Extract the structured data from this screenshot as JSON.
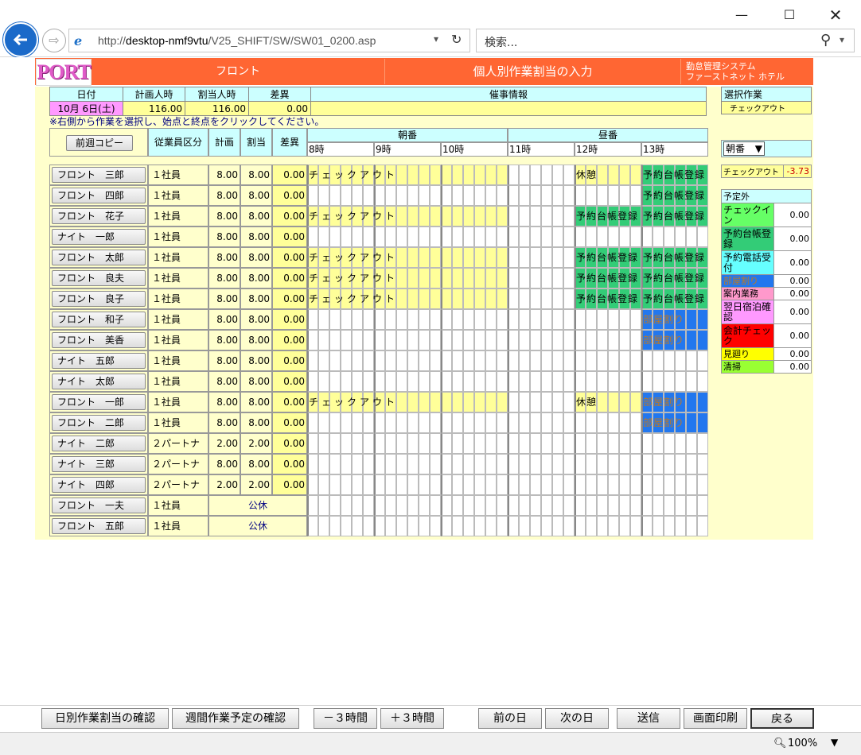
{
  "browser": {
    "url_prefix": "http://",
    "url_host": "desktop-nmf9vtu",
    "url_path": "/V25_SHIFT/SW/SW01_0200.asp",
    "search_placeholder": "検索...",
    "zoom": "100%"
  },
  "header": {
    "logo": "PORT",
    "section": "フロント",
    "title": "個人別作業割当の入力",
    "system": "勤怠管理システム",
    "hotel": "ファーストネット ホテル"
  },
  "summary": {
    "col_date": "日付",
    "col_plan": "計画人時",
    "col_assign": "割当人時",
    "col_diff": "差異",
    "col_event": "催事情報",
    "date": "10月 6日(土)",
    "plan": "116.00",
    "assign": "116.00",
    "diff": "0.00",
    "event": ""
  },
  "instruction": "※右側から作業を選択し、始点と終点をクリックしてください。",
  "controls": {
    "copy_button": "前週コピー",
    "col_type": "従業員区分",
    "col_plan": "計画",
    "col_assign": "割当",
    "col_diff": "差異",
    "shift_morning": "朝番",
    "shift_day": "昼番",
    "hours": [
      "8時",
      "9時",
      "10時",
      "11時",
      "12時",
      "13時"
    ],
    "shift_select": "朝番"
  },
  "selected_task": {
    "heading": "選択作業",
    "value": "チェックアウト"
  },
  "task_top": {
    "name": "チェックアウト",
    "value": "-3.73"
  },
  "unscheduled": {
    "heading": "予定外",
    "items": [
      {
        "name": "チェックイン",
        "value": "0.00",
        "color": "#66ff66"
      },
      {
        "name": "予約台帳登録",
        "value": "0.00",
        "color": "#33cc77"
      },
      {
        "name": "予約電話受付",
        "value": "0.00",
        "color": "#66ffff"
      },
      {
        "name": "部屋割り",
        "value": "0.00",
        "color": "#2277ee"
      },
      {
        "name": "案内業務",
        "value": "0.00",
        "color": "#ff99cc"
      },
      {
        "name": "翌日宿泊確認",
        "value": "0.00",
        "color": "#ff99ff"
      },
      {
        "name": "会計チェック",
        "value": "0.00",
        "color": "#ff0000"
      },
      {
        "name": "見廻り",
        "value": "0.00",
        "color": "#ffff00"
      },
      {
        "name": "清掃",
        "value": "0.00",
        "color": "#99ff33"
      }
    ]
  },
  "labels": {
    "checkout": "チェックアウト",
    "break": "休憩",
    "booking": "予約台帳登録",
    "rooms": "部屋割り",
    "off": "公休"
  },
  "employees": [
    {
      "name": "フロント　三郎",
      "type": "１社員",
      "plan": "8.00",
      "assign": "8.00",
      "diff": "0.00",
      "pattern": "A"
    },
    {
      "name": "フロント　四郎",
      "type": "１社員",
      "plan": "8.00",
      "assign": "8.00",
      "diff": "0.00",
      "pattern": "B"
    },
    {
      "name": "フロント　花子",
      "type": "１社員",
      "plan": "8.00",
      "assign": "8.00",
      "diff": "0.00",
      "pattern": "C"
    },
    {
      "name": "ナイト　一郎",
      "type": "１社員",
      "plan": "8.00",
      "assign": "8.00",
      "diff": "0.00",
      "pattern": "E"
    },
    {
      "name": "フロント　太郎",
      "type": "１社員",
      "plan": "8.00",
      "assign": "8.00",
      "diff": "0.00",
      "pattern": "C"
    },
    {
      "name": "フロント　良夫",
      "type": "１社員",
      "plan": "8.00",
      "assign": "8.00",
      "diff": "0.00",
      "pattern": "C"
    },
    {
      "name": "フロント　良子",
      "type": "１社員",
      "plan": "8.00",
      "assign": "8.00",
      "diff": "0.00",
      "pattern": "C"
    },
    {
      "name": "フロント　和子",
      "type": "１社員",
      "plan": "8.00",
      "assign": "8.00",
      "diff": "0.00",
      "pattern": "D"
    },
    {
      "name": "フロント　美香",
      "type": "１社員",
      "plan": "8.00",
      "assign": "8.00",
      "diff": "0.00",
      "pattern": "D"
    },
    {
      "name": "ナイト　五郎",
      "type": "１社員",
      "plan": "8.00",
      "assign": "8.00",
      "diff": "0.00",
      "pattern": "E"
    },
    {
      "name": "ナイト　太郎",
      "type": "１社員",
      "plan": "8.00",
      "assign": "8.00",
      "diff": "0.00",
      "pattern": "E"
    },
    {
      "name": "フロント　一郎",
      "type": "１社員",
      "plan": "8.00",
      "assign": "8.00",
      "diff": "0.00",
      "pattern": "F"
    },
    {
      "name": "フロント　二郎",
      "type": "１社員",
      "plan": "8.00",
      "assign": "8.00",
      "diff": "0.00",
      "pattern": "D"
    },
    {
      "name": "ナイト　二郎",
      "type": "２パートナ",
      "plan": "2.00",
      "assign": "2.00",
      "diff": "0.00",
      "pattern": "E"
    },
    {
      "name": "ナイト　三郎",
      "type": "２パートナ",
      "plan": "8.00",
      "assign": "8.00",
      "diff": "0.00",
      "pattern": "E"
    },
    {
      "name": "ナイト　四郎",
      "type": "２パートナ",
      "plan": "2.00",
      "assign": "2.00",
      "diff": "0.00",
      "pattern": "E"
    },
    {
      "name": "フロント　一夫",
      "type": "１社員",
      "plan": "",
      "assign": "",
      "diff": "",
      "pattern": "E",
      "off": true
    },
    {
      "name": "フロント　五郎",
      "type": "１社員",
      "plan": "",
      "assign": "",
      "diff": "",
      "pattern": "E",
      "off": true
    }
  ],
  "footer": {
    "daily": "日別作業割当の確認",
    "weekly": "週間作業予定の確認",
    "minus3": "－３時間",
    "plus3": "＋３時間",
    "prev": "前の日",
    "next": "次の日",
    "send": "送信",
    "print": "画面印刷",
    "back": "戻る"
  }
}
